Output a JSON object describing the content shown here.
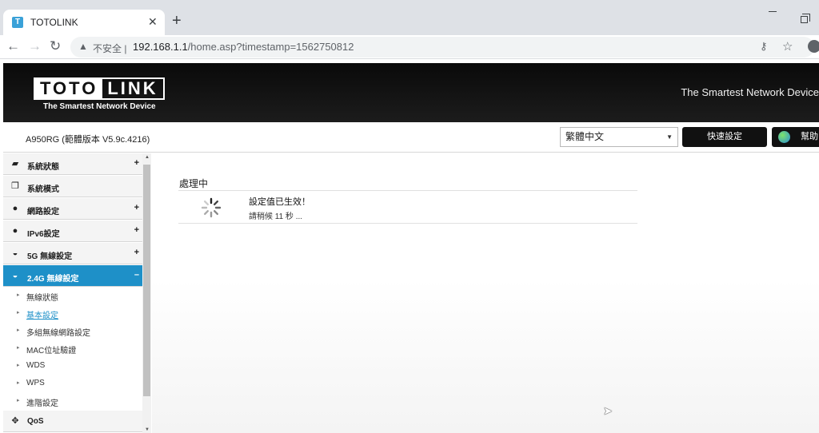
{
  "browser": {
    "tab_title": "TOTOLINK",
    "favicon_letter": "T",
    "new_tab": "+",
    "insecure_label": "不安全",
    "url_host": "192.168.1.1",
    "url_path": "/home.asp?timestamp=1562750812"
  },
  "header": {
    "logo_left": "TOTO",
    "logo_right": "LINK",
    "logo_tagline": "The Smartest Network Device",
    "slogan": "The Smartest Network Device"
  },
  "subbar": {
    "model": "A950RG (範體版本 V5.9c.4216)",
    "language": "繁體中文",
    "quick_setup": "快速設定",
    "help": "幫助"
  },
  "sidebar": {
    "items": [
      {
        "label": "系統狀態",
        "icon": "chat-icon",
        "expand": "+"
      },
      {
        "label": "系統模式",
        "icon": "windows-icon",
        "expand": ""
      },
      {
        "label": "網路設定",
        "icon": "globe-icon",
        "expand": "+"
      },
      {
        "label": "IPv6設定",
        "icon": "ipv6-icon",
        "expand": "+"
      },
      {
        "label": "5G 無線設定",
        "icon": "wifi-icon",
        "expand": "+"
      },
      {
        "label": "2.4G 無線設定",
        "icon": "wifi-icon",
        "expand": "–"
      }
    ],
    "subitems": [
      {
        "label": "無線狀態"
      },
      {
        "label": "基本設定"
      },
      {
        "label": "多組無線網路設定"
      },
      {
        "label": "MAC位址驗證"
      },
      {
        "label": "WDS"
      },
      {
        "label": "WPS"
      },
      {
        "label": "進階設定"
      }
    ],
    "qos": {
      "label": "QoS",
      "icon": "qos-icon"
    }
  },
  "content": {
    "title": "處理中",
    "message": "設定值已生效！",
    "wait": "請稍候 11 秒 ..."
  }
}
